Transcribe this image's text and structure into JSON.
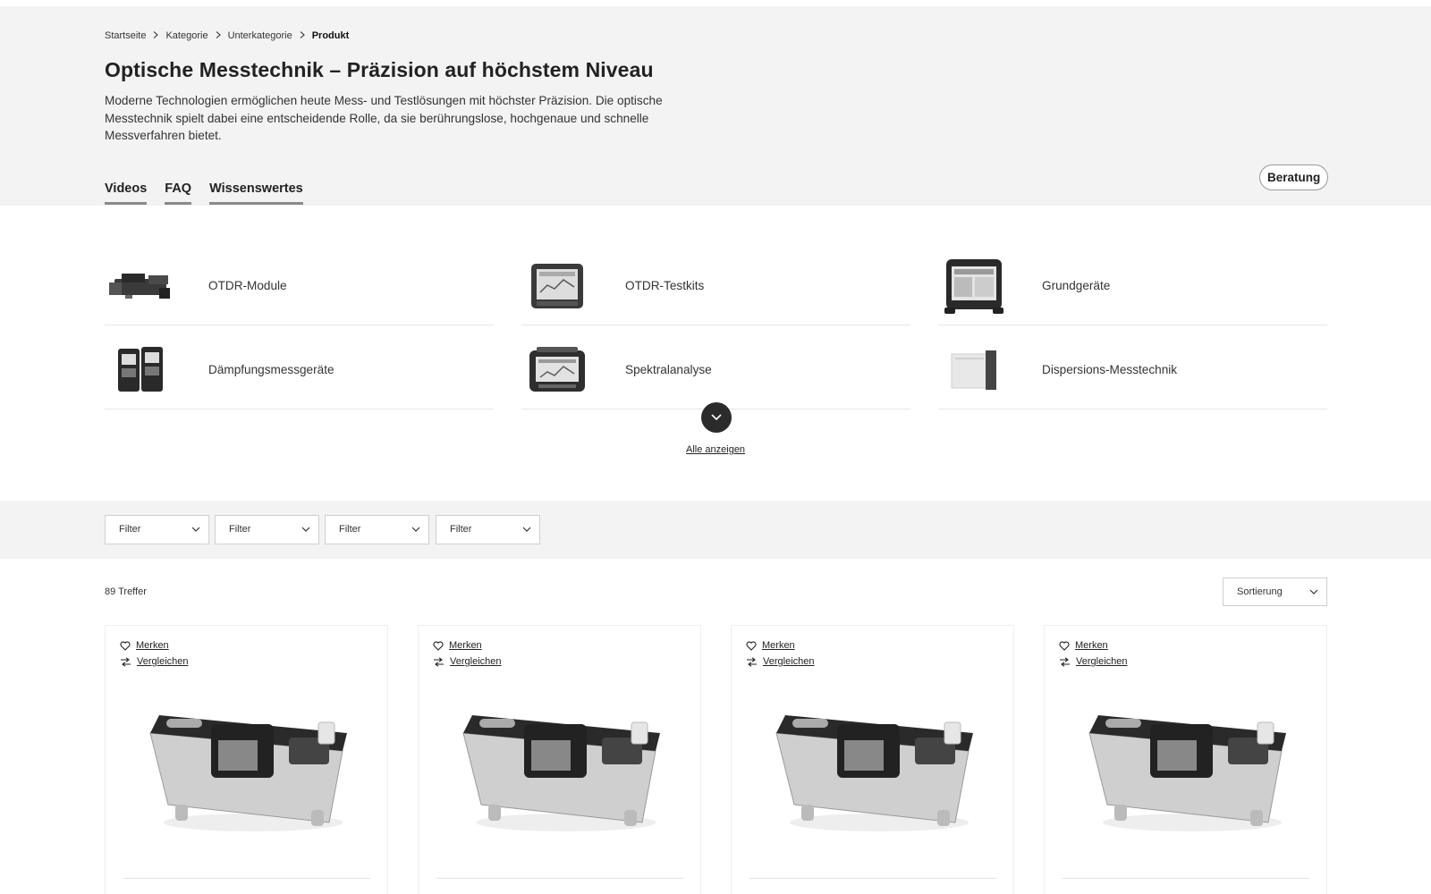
{
  "breadcrumb": [
    "Startseite",
    "Kategorie",
    "Unterkategorie",
    "Produkt"
  ],
  "title": "Optische Messtechnik – Präzision auf höchstem Niveau",
  "intro": "Moderne Technologien ermöglichen heute Mess- und Testlösungen mit höchster Präzision. Die optische Messtechnik spielt dabei eine entscheidende Rolle, da sie berührungslose, hochgenaue und schnelle Messverfahren bietet.",
  "tabs": [
    "Videos",
    "FAQ",
    "Wissenswertes"
  ],
  "beratung_label": "Beratung",
  "categories": [
    {
      "label": "OTDR-Module",
      "icon": "otdr-module-icon"
    },
    {
      "label": "OTDR-Testkits",
      "icon": "otdr-testkit-icon"
    },
    {
      "label": "Grundgeräte",
      "icon": "base-device-icon"
    },
    {
      "label": "Dämpfungsmessgeräte",
      "icon": "attenuation-meter-icon"
    },
    {
      "label": "Spektralanalyse",
      "icon": "spectrum-analyzer-icon"
    },
    {
      "label": "Dispersions-Messtechnik",
      "icon": "dispersion-device-icon"
    }
  ],
  "show_all_label": "Alle anzeigen",
  "filters": [
    "Filter",
    "Filter",
    "Filter",
    "Filter"
  ],
  "hits_label": "89 Treffer",
  "sort_label": "Sortierung",
  "product_cards": [
    {
      "merken": "Merken",
      "vergleichen": "Vergleichen"
    },
    {
      "merken": "Merken",
      "vergleichen": "Vergleichen"
    },
    {
      "merken": "Merken",
      "vergleichen": "Vergleichen"
    },
    {
      "merken": "Merken",
      "vergleichen": "Vergleichen"
    }
  ]
}
